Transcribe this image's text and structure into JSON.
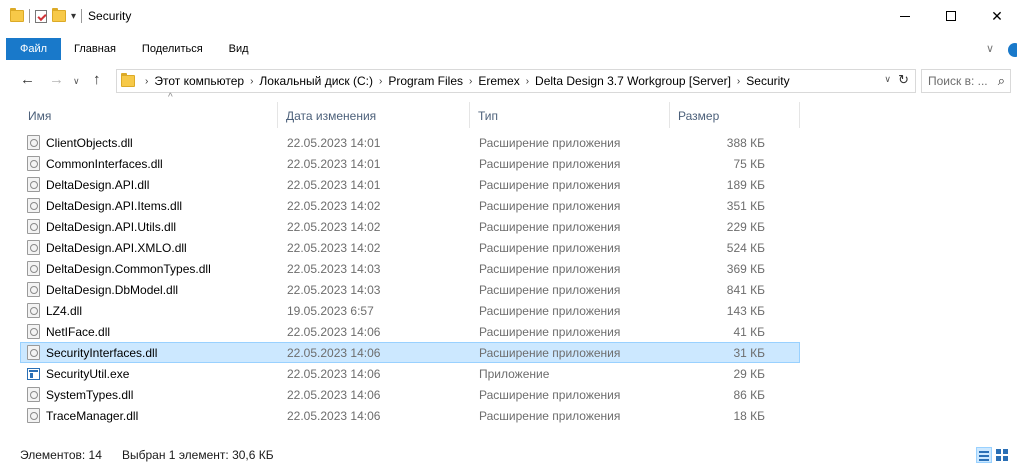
{
  "window": {
    "title": "Security"
  },
  "ribbon": {
    "tabs": [
      "Файл",
      "Главная",
      "Поделиться",
      "Вид"
    ]
  },
  "address": {
    "crumbs": [
      "Этот компьютер",
      "Локальный диск (C:)",
      "Program Files",
      "Eremex",
      "Delta Design 3.7 Workgroup [Server]",
      "Security"
    ]
  },
  "search": {
    "placeholder": "Поиск в: ..."
  },
  "columns": {
    "name": "Имя",
    "date": "Дата изменения",
    "type": "Тип",
    "size": "Размер"
  },
  "files": [
    {
      "name": "ClientObjects.dll",
      "date": "22.05.2023 14:01",
      "type": "Расширение приложения",
      "size": "388 КБ",
      "icon": "dll-file-icon",
      "selected": false
    },
    {
      "name": "CommonInterfaces.dll",
      "date": "22.05.2023 14:01",
      "type": "Расширение приложения",
      "size": "75 КБ",
      "icon": "dll-file-icon",
      "selected": false
    },
    {
      "name": "DeltaDesign.API.dll",
      "date": "22.05.2023 14:01",
      "type": "Расширение приложения",
      "size": "189 КБ",
      "icon": "dll-file-icon",
      "selected": false
    },
    {
      "name": "DeltaDesign.API.Items.dll",
      "date": "22.05.2023 14:02",
      "type": "Расширение приложения",
      "size": "351 КБ",
      "icon": "dll-file-icon",
      "selected": false
    },
    {
      "name": "DeltaDesign.API.Utils.dll",
      "date": "22.05.2023 14:02",
      "type": "Расширение приложения",
      "size": "229 КБ",
      "icon": "dll-file-icon",
      "selected": false
    },
    {
      "name": "DeltaDesign.API.XMLO.dll",
      "date": "22.05.2023 14:02",
      "type": "Расширение приложения",
      "size": "524 КБ",
      "icon": "dll-file-icon",
      "selected": false
    },
    {
      "name": "DeltaDesign.CommonTypes.dll",
      "date": "22.05.2023 14:03",
      "type": "Расширение приложения",
      "size": "369 КБ",
      "icon": "dll-file-icon",
      "selected": false
    },
    {
      "name": "DeltaDesign.DbModel.dll",
      "date": "22.05.2023 14:03",
      "type": "Расширение приложения",
      "size": "841 КБ",
      "icon": "dll-file-icon",
      "selected": false
    },
    {
      "name": "LZ4.dll",
      "date": "19.05.2023 6:57",
      "type": "Расширение приложения",
      "size": "143 КБ",
      "icon": "dll-file-icon",
      "selected": false
    },
    {
      "name": "NetIFace.dll",
      "date": "22.05.2023 14:06",
      "type": "Расширение приложения",
      "size": "41 КБ",
      "icon": "dll-file-icon",
      "selected": false
    },
    {
      "name": "SecurityInterfaces.dll",
      "date": "22.05.2023 14:06",
      "type": "Расширение приложения",
      "size": "31 КБ",
      "icon": "dll-file-icon",
      "selected": true
    },
    {
      "name": "SecurityUtil.exe",
      "date": "22.05.2023 14:06",
      "type": "Приложение",
      "size": "29 КБ",
      "icon": "exe-file-icon",
      "selected": false
    },
    {
      "name": "SystemTypes.dll",
      "date": "22.05.2023 14:06",
      "type": "Расширение приложения",
      "size": "86 КБ",
      "icon": "dll-file-icon",
      "selected": false
    },
    {
      "name": "TraceManager.dll",
      "date": "22.05.2023 14:06",
      "type": "Расширение приложения",
      "size": "18 КБ",
      "icon": "dll-file-icon",
      "selected": false
    }
  ],
  "status": {
    "count": "Элементов: 14",
    "selection": "Выбран 1 элемент: 30,6 КБ"
  },
  "colors": {
    "accent": "#1979ca",
    "selection_bg": "#cce8ff",
    "selection_border": "#99d1ff",
    "header_text": "#4c607a"
  }
}
